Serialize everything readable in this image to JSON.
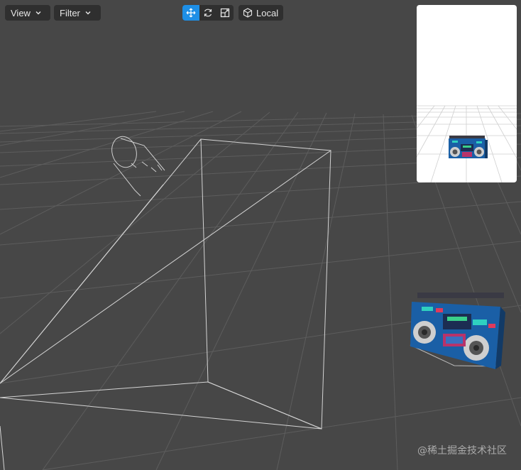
{
  "toolbar": {
    "view_label": "View",
    "filter_label": "Filter",
    "space_label": "Local",
    "tools": [
      {
        "name": "move",
        "active": true
      },
      {
        "name": "rotate",
        "active": false
      },
      {
        "name": "scale",
        "active": false
      }
    ]
  },
  "scene": {
    "objects": [
      "camera-gizmo",
      "camera-frustum",
      "boombox"
    ],
    "selected_tool_color": "#1e8fe6",
    "background_color": "#474747",
    "grid_color": "#5a5a5a"
  },
  "preview": {
    "background_color": "#ffffff"
  },
  "watermark": "@稀土掘金技术社区"
}
